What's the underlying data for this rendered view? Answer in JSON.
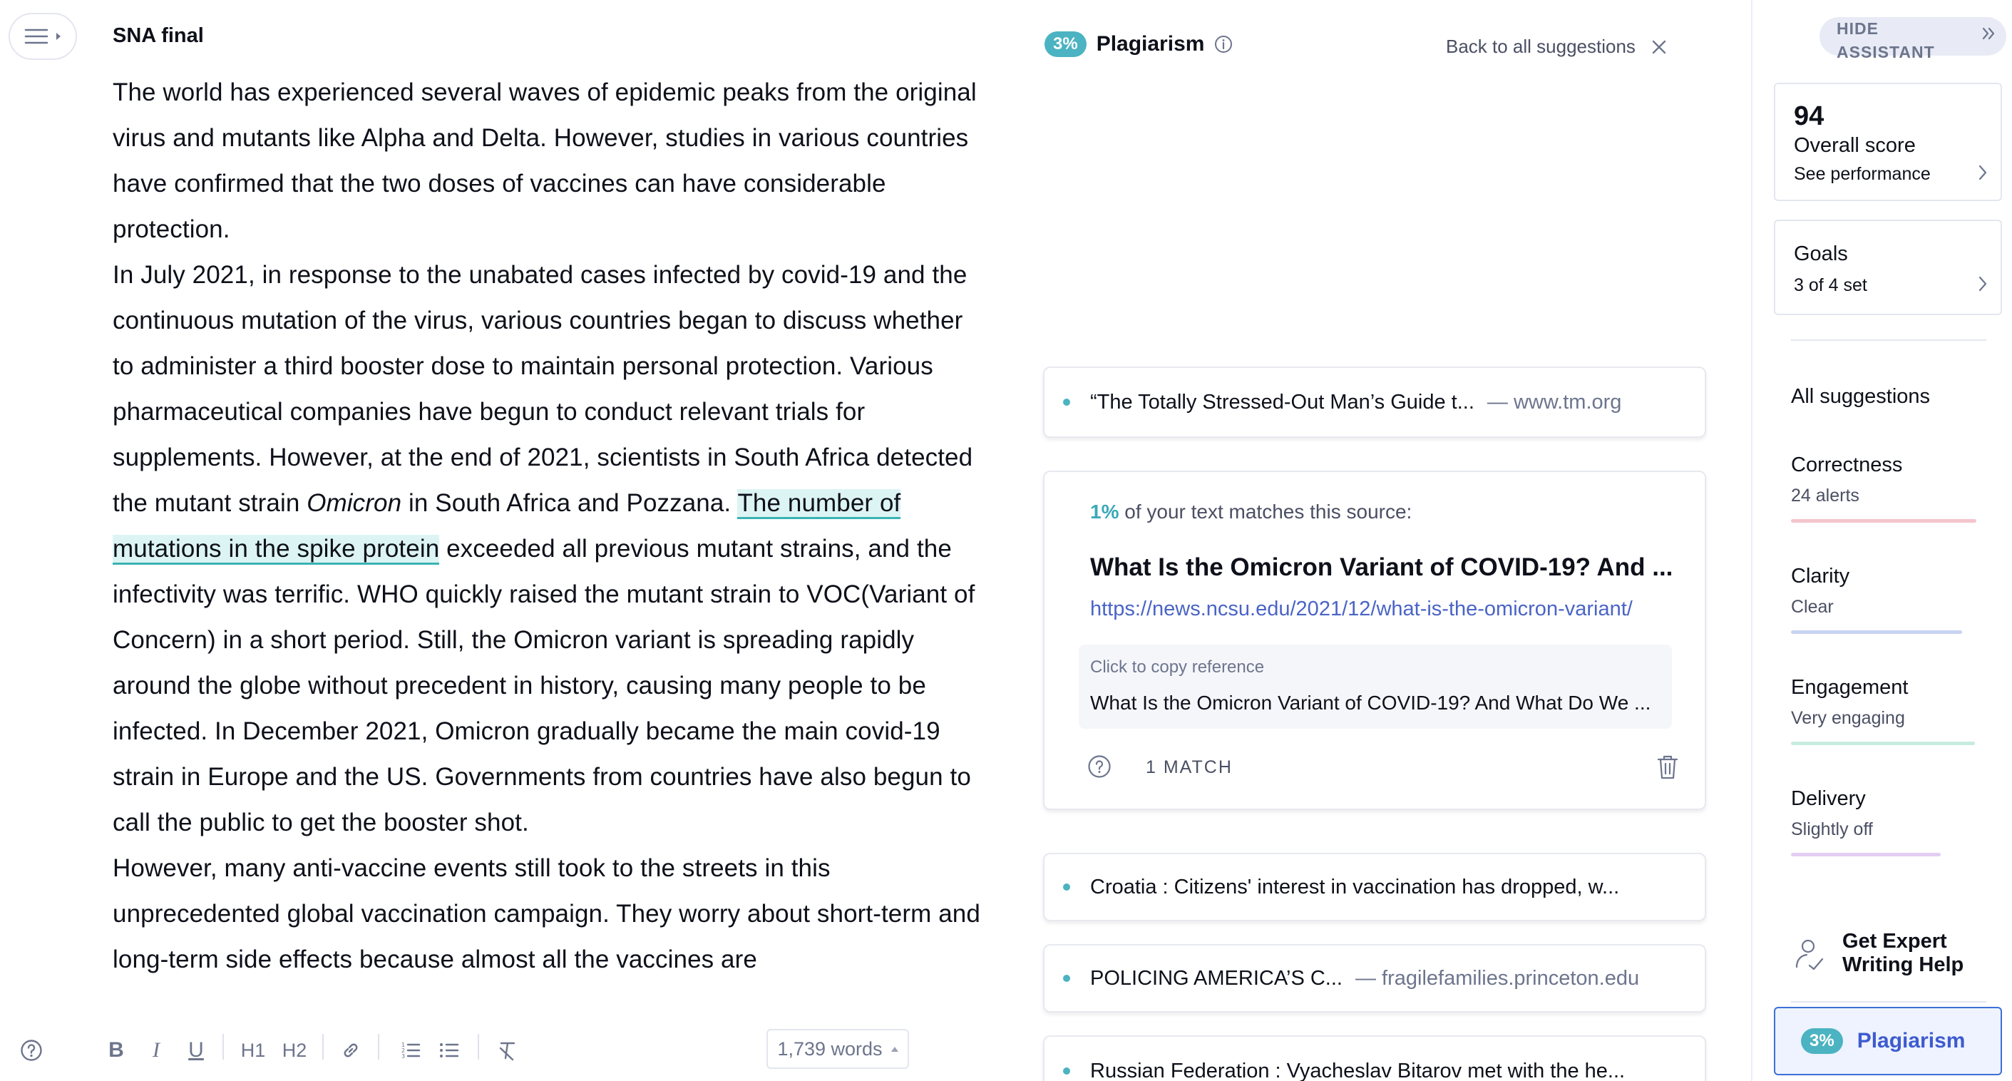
{
  "document": {
    "title": "SNA final",
    "para1": "The world has experienced several waves of epidemic peaks from the original virus and mutants like Alpha and Delta. However, studies in various countries have confirmed that the two doses of vaccines can have considerable protection.",
    "para2_a": "In July 2021, in response to the unabated cases infected by covid-19 and the continuous mutation of the virus, various countries began to discuss whether to administer a third booster dose to maintain personal protection. Various pharmaceutical companies have begun to conduct relevant trials for supplements. However, at the end of 2021, scientists in South Africa detected the mutant strain ",
    "para2_italic": "Omicron",
    "para2_b": " in South Africa and Pozzana. ",
    "para2_highlight": "The number of mutations in the spike protein",
    "para2_c": " exceeded all previous mutant strains, and the infectivity was terrific. WHO quickly raised the mutant strain to VOC(Variant of Concern) in a short period. Still, the Omicron variant is spreading rapidly around the globe without precedent in history, causing many people to be infected. In December 2021, Omicron gradually became the main covid-19 strain in Europe and the US. Governments from countries have also begun to call the public to get the booster shot.",
    "para3": "However, many anti-vaccine events still took to the streets in this unprecedented global vaccination campaign. They worry about short-term and long-term side effects because almost all the vaccines are"
  },
  "toolbar": {
    "bold": "B",
    "italic": "I",
    "underline": "U",
    "h1": "H1",
    "h2": "H2",
    "word_count": "1,739 words"
  },
  "plagiarism": {
    "percent": "3%",
    "title": "Plagiarism",
    "back_label": "Back to all suggestions",
    "sources": [
      {
        "title": "“The Totally Stressed-Out Man’s Guide t...",
        "domain": "— www.tm.org"
      },
      {
        "title": "Croatia : Citizens' interest in vaccination has dropped, w...",
        "domain": ""
      },
      {
        "title": "POLICING AMERICA’S C...",
        "domain": "— fragilefamilies.princeton.edu"
      },
      {
        "title": "Russian Federation : Vyacheslav Bitarov met with the he...",
        "domain": ""
      }
    ],
    "expanded": {
      "match_pct": "1%",
      "match_text": "of your text matches this source:",
      "title": "What Is the Omicron Variant of COVID-19? And ...",
      "url": "https://news.ncsu.edu/2021/12/what-is-the-omicron-variant/",
      "copy_label": "Click to copy reference",
      "copy_text": "What Is the Omicron Variant of COVID-19? And What Do We ...",
      "match_count": "1 MATCH"
    }
  },
  "assistant": {
    "hide_label": "HIDE\nASSISTANT",
    "score": "94",
    "score_label": "Overall score",
    "score_link": "See performance",
    "goals_label": "Goals",
    "goals_status": "3 of 4 set",
    "all_suggestions": "All suggestions",
    "categories": [
      {
        "name": "Correctness",
        "status": "24 alerts",
        "color": "#f4c4cc"
      },
      {
        "name": "Clarity",
        "status": "Clear",
        "color": "#c9d3f3"
      },
      {
        "name": "Engagement",
        "status": "Very engaging",
        "color": "#c7ecdd"
      },
      {
        "name": "Delivery",
        "status": "Slightly off",
        "color": "#e3cdf2"
      }
    ],
    "expert_label": "Get Expert\nWriting Help",
    "plag_percent": "3%",
    "plag_label": "Plagiarism"
  }
}
